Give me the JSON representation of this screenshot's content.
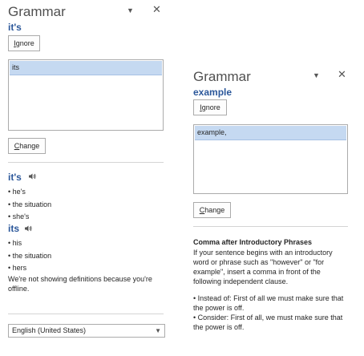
{
  "left_pane": {
    "title": "Grammar",
    "flagged_word": "it's",
    "ignore_label": "Ignore",
    "ignore_accel": "I",
    "ignore_rest": "gnore",
    "suggestion": "its",
    "change_label": "Change",
    "change_accel": "C",
    "change_rest": "hange",
    "pin_icon": "chevron-down-icon",
    "close_icon": "close-icon",
    "definitions": [
      {
        "word": "it's",
        "items": [
          "• he's",
          "• the situation",
          "• she's"
        ]
      },
      {
        "word": "its",
        "items": [
          "• his",
          "• the situation",
          "• hers"
        ]
      }
    ],
    "offline_note": "We're not showing definitions because you're offline.",
    "language": "English (United States)"
  },
  "right_pane": {
    "title": "Grammar",
    "flagged_word": "example",
    "ignore_label": "Ignore",
    "ignore_accel": "I",
    "ignore_rest": "gnore",
    "suggestion": "example,",
    "change_label": "Change",
    "change_accel": "C",
    "change_rest": "hange",
    "explanation_title": "Comma after Introductory Phrases",
    "explanation_body": "If your sentence begins with an introductory word or phrase such as \"however\" or \"for example\", insert a comma in front of the following independent clause.",
    "examples": [
      "• Instead of: First of all we must make sure that the power is off.",
      "• Consider: First of all, we must make sure that the power is off."
    ]
  }
}
